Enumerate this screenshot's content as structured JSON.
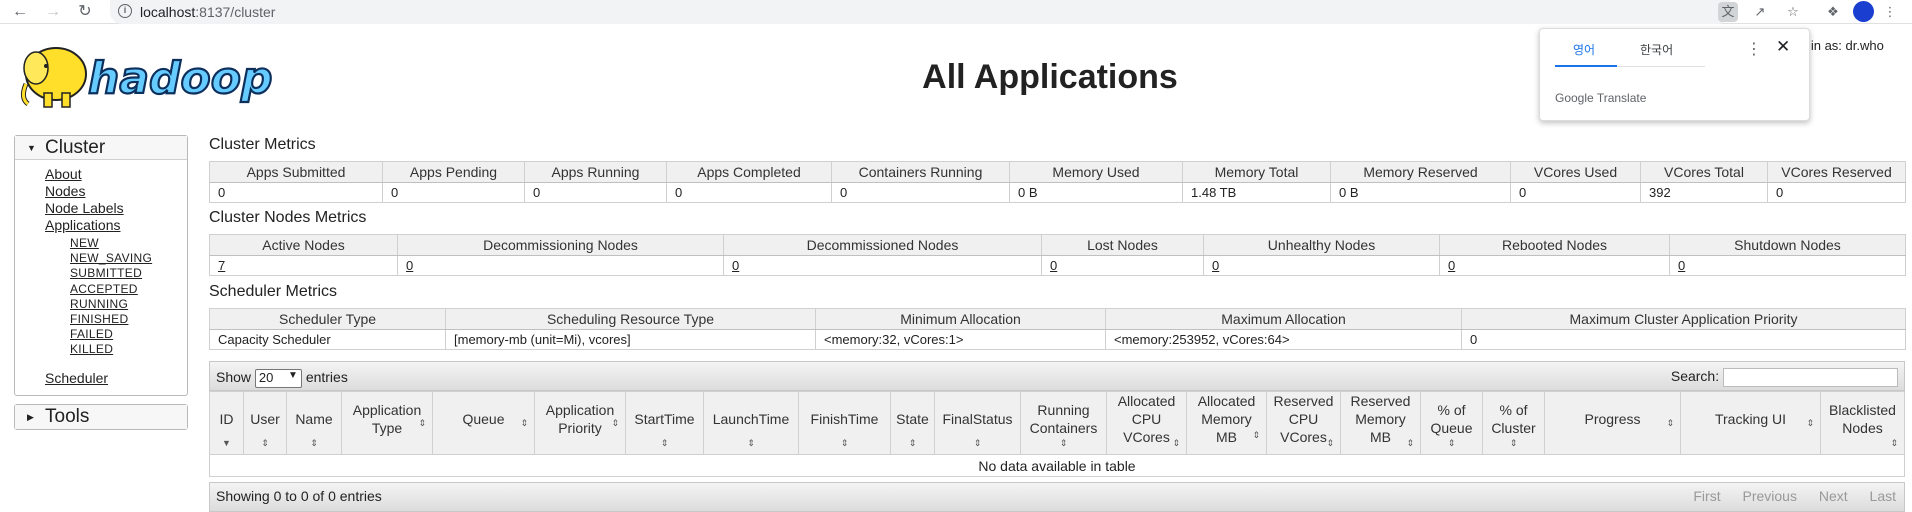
{
  "browser": {
    "url_host": "localhost",
    "url_rest": ":8137/cluster",
    "translate": {
      "tab_active": "영어",
      "tab_other": "한국어",
      "brand": "Google Translate"
    }
  },
  "header": {
    "logo_text": "hadoop",
    "title": "All Applications",
    "logged_in": "d in as: dr.who"
  },
  "sidebar": {
    "cluster_label": "Cluster",
    "links": [
      "About",
      "Nodes",
      "Node Labels",
      "Applications"
    ],
    "app_states": [
      "NEW",
      "NEW_SAVING",
      "SUBMITTED",
      "ACCEPTED",
      "RUNNING",
      "FINISHED",
      "FAILED",
      "KILLED"
    ],
    "scheduler_link": "Scheduler",
    "tools_label": "Tools"
  },
  "cluster_metrics": {
    "title": "Cluster Metrics",
    "headers": [
      "Apps Submitted",
      "Apps Pending",
      "Apps Running",
      "Apps Completed",
      "Containers Running",
      "Memory Used",
      "Memory Total",
      "Memory Reserved",
      "VCores Used",
      "VCores Total",
      "VCores Reserved"
    ],
    "values": [
      "0",
      "0",
      "0",
      "0",
      "0",
      "0 B",
      "1.48 TB",
      "0 B",
      "0",
      "392",
      "0"
    ]
  },
  "nodes_metrics": {
    "title": "Cluster Nodes Metrics",
    "headers": [
      "Active Nodes",
      "Decommissioning Nodes",
      "Decommissioned Nodes",
      "Lost Nodes",
      "Unhealthy Nodes",
      "Rebooted Nodes",
      "Shutdown Nodes"
    ],
    "values": [
      "7",
      "0",
      "0",
      "0",
      "0",
      "0",
      "0"
    ]
  },
  "scheduler_metrics": {
    "title": "Scheduler Metrics",
    "headers": [
      "Scheduler Type",
      "Scheduling Resource Type",
      "Minimum Allocation",
      "Maximum Allocation",
      "Maximum Cluster Application Priority"
    ],
    "values": [
      "Capacity Scheduler",
      "[memory-mb (unit=Mi), vcores]",
      "<memory:32, vCores:1>",
      "<memory:253952, vCores:64>",
      "0"
    ]
  },
  "apps_table": {
    "show_label": "Show",
    "entries_label": "entries",
    "page_size": "20",
    "search_label": "Search:",
    "columns": [
      "ID",
      "User",
      "Name",
      "Application Type",
      "Queue",
      "Application Priority",
      "StartTime",
      "LaunchTime",
      "FinishTime",
      "State",
      "FinalStatus",
      "Running Containers",
      "Allocated CPU VCores",
      "Allocated Memory MB",
      "Reserved CPU VCores",
      "Reserved Memory MB",
      "% of Queue",
      "% of Cluster",
      "Progress",
      "Tracking UI",
      "Blacklisted Nodes"
    ],
    "empty_message": "No data available in table",
    "info": "Showing 0 to 0 of 0 entries",
    "pager": [
      "First",
      "Previous",
      "Next",
      "Last"
    ]
  }
}
